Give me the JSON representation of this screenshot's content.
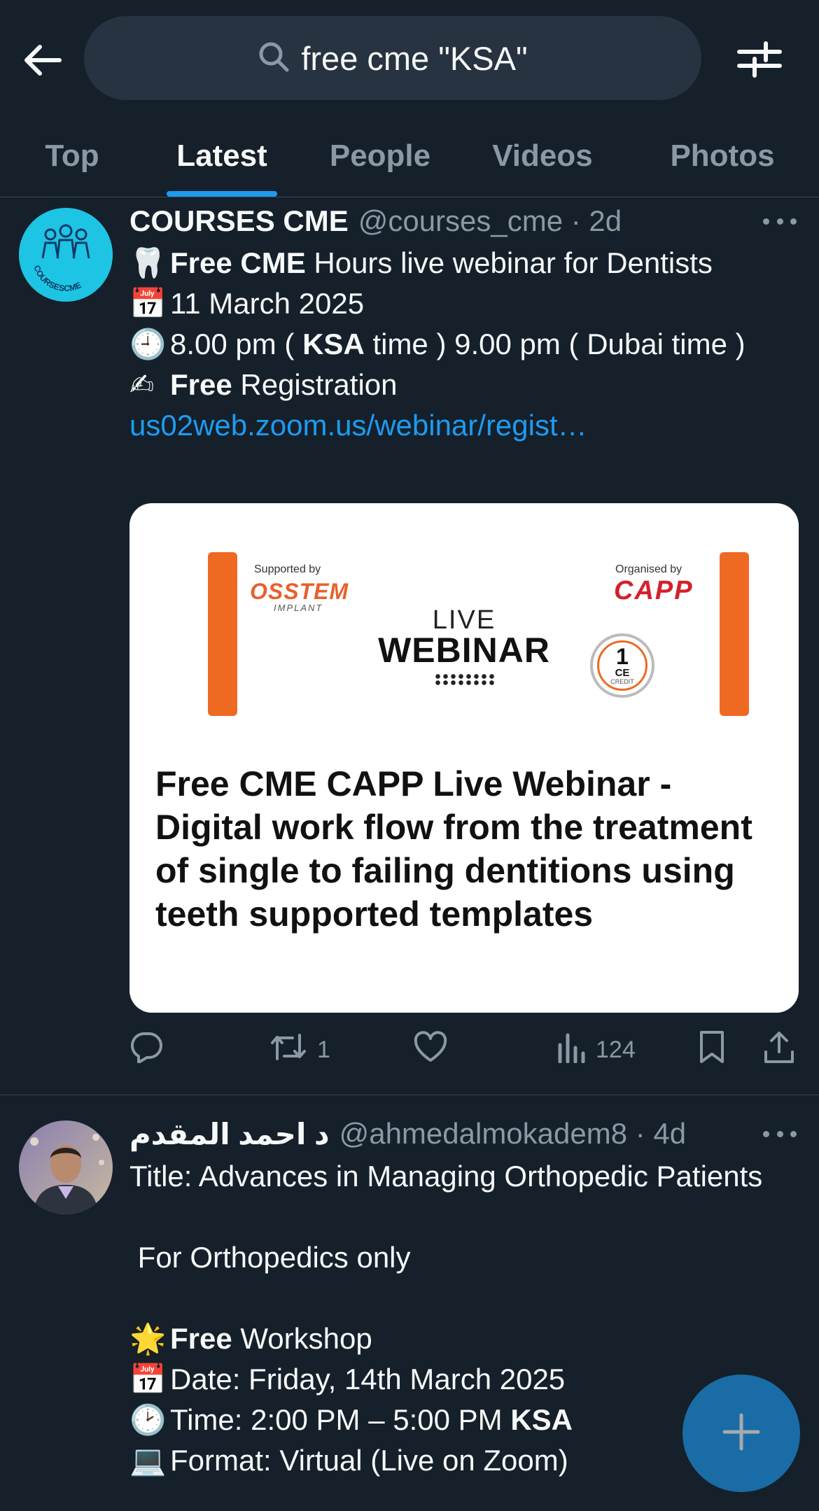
{
  "search": {
    "query": "free cme \"KSA\""
  },
  "tabs": [
    {
      "label": "Top"
    },
    {
      "label": "Latest"
    },
    {
      "label": "People"
    },
    {
      "label": "Videos"
    },
    {
      "label": "Photos"
    }
  ],
  "active_tab": "Latest",
  "tweets": [
    {
      "display_name": "COURSES CME",
      "meta": "@courses_cme · 2d",
      "avatar_text": "COURSESCME",
      "lines": {
        "l1_bold": "Free CME",
        "l1_rest": " Hours live webinar for Dentists",
        "l2": "11 March 2025",
        "l3_a": "8.00 pm ( ",
        "l3_bold": "KSA",
        "l3_b": " time ) 9.00 pm ( Dubai time )",
        "l4_bold": "Free",
        "l4_rest": " Registration",
        "link": "us02web.zoom.us/webinar/regist…"
      },
      "card": {
        "supported_by": "Supported by",
        "sponsor": "OSSTEM",
        "sponsor_sub": "IMPLANT",
        "organised_by": "Organised by",
        "organiser": "CAPP",
        "live": "LIVE",
        "webinar": "WEBINAR",
        "badge_num": "1",
        "badge_ce": "CE",
        "badge_credit": "CREDIT",
        "title": "Free CME CAPP Live Webinar - Digital work flow from the treatment of single to failing dentitions using teeth supported templates"
      },
      "stats": {
        "retweets": "1",
        "views": "124"
      }
    },
    {
      "display_name": "د احمد المقدم",
      "meta": "@ahmedalmokadem8 · 4d",
      "lines": {
        "l1": "Title: Advances in Managing Orthopedic Patients",
        "l2": " For Orthopedics only",
        "l3_bold": "Free",
        "l3_rest": " Workshop",
        "l4": "Date: Friday, 14th March 2025",
        "l5_a": "Time: 2:00 PM – 5:00 PM ",
        "l5_bold": "KSA",
        "l6": "Format: Virtual (Live on Zoom)"
      }
    }
  ],
  "colors": {
    "background": "#15202b",
    "accent": "#1d9bf0",
    "muted": "#8b98a5",
    "card_orange": "#ee6a23"
  }
}
